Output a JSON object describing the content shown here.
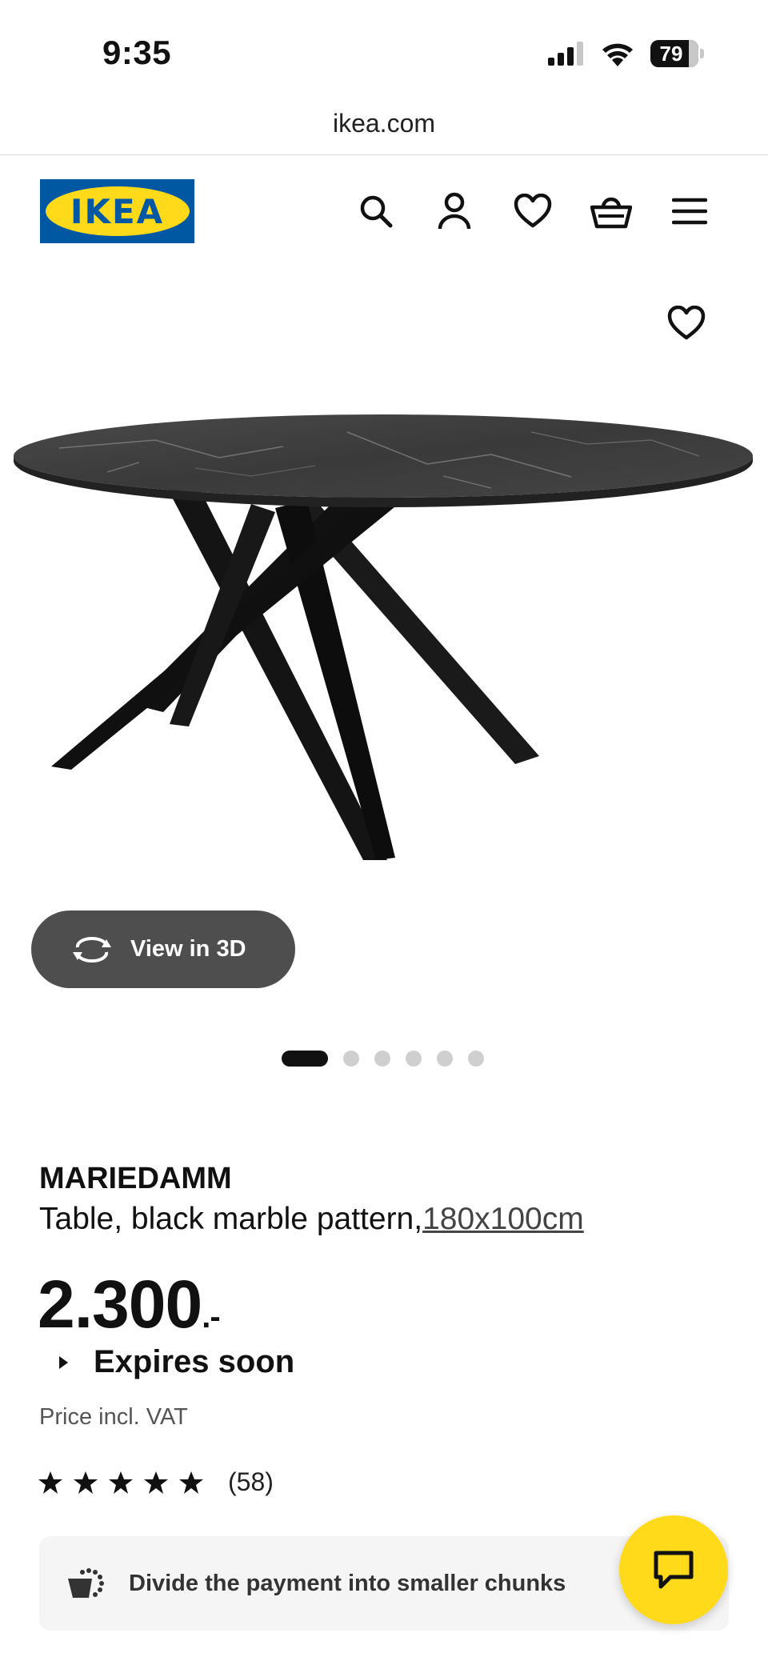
{
  "status_bar": {
    "time": "9:35",
    "battery": "79"
  },
  "browser": {
    "url": "ikea.com"
  },
  "header": {
    "logo_text": "IKEA",
    "icons": [
      "search-icon",
      "account-icon",
      "heart-icon",
      "basket-icon",
      "menu-icon"
    ]
  },
  "gallery": {
    "view3d_label": "View in 3D",
    "slide_count": 6,
    "active_slide": 1
  },
  "product": {
    "name": "MARIEDAMM",
    "description": "Table, black marble pattern,",
    "size": "180x100cm",
    "price": "2.300",
    "price_suffix": ".-",
    "expires_label": "Expires soon",
    "vat_note": "Price incl. VAT",
    "rating_stars": 5,
    "rating_count": "(58)"
  },
  "payment": {
    "label": "Divide the payment into smaller chunks"
  },
  "colors": {
    "ikea_blue": "#0058a3",
    "ikea_yellow": "#ffda1a",
    "pill_gray": "#4e4e4e"
  }
}
